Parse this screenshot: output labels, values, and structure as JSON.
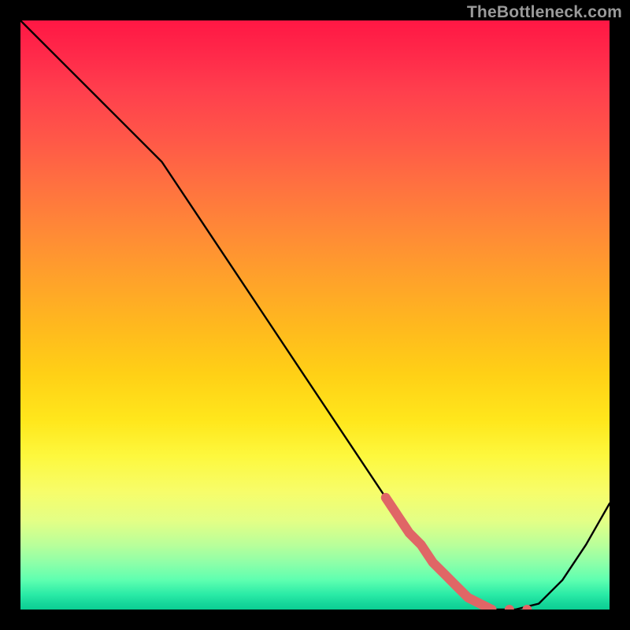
{
  "watermark": "TheBottleneck.com",
  "chart_data": {
    "type": "line",
    "title": "",
    "xlabel": "",
    "ylabel": "",
    "xlim": [
      0,
      100
    ],
    "ylim": [
      0,
      100
    ],
    "grid": false,
    "series": [
      {
        "name": "bottleneck-curve",
        "x": [
          0,
          8,
          16,
          24,
          32,
          40,
          48,
          56,
          62,
          68,
          72,
          76,
          80,
          84,
          88,
          92,
          96,
          100
        ],
        "y": [
          100,
          92,
          84,
          76,
          64,
          52,
          40,
          28,
          19,
          11,
          6,
          2,
          0,
          0,
          1,
          5,
          11,
          18
        ]
      }
    ],
    "highlight_segment": {
      "name": "typical-range",
      "x": [
        62,
        64,
        66,
        68,
        70,
        72,
        74,
        76,
        78,
        80
      ],
      "y": [
        19,
        16,
        13,
        11,
        8,
        6,
        4,
        2,
        1,
        0
      ]
    },
    "highlight_points": {
      "name": "recommended-zone",
      "points": [
        {
          "x": 80,
          "y": 0
        },
        {
          "x": 83,
          "y": 0
        },
        {
          "x": 86,
          "y": 0
        }
      ]
    },
    "colors": {
      "curve": "#000000",
      "highlight": "#e06666",
      "background_top": "#ff1744",
      "background_bottom": "#0bcf93"
    }
  }
}
